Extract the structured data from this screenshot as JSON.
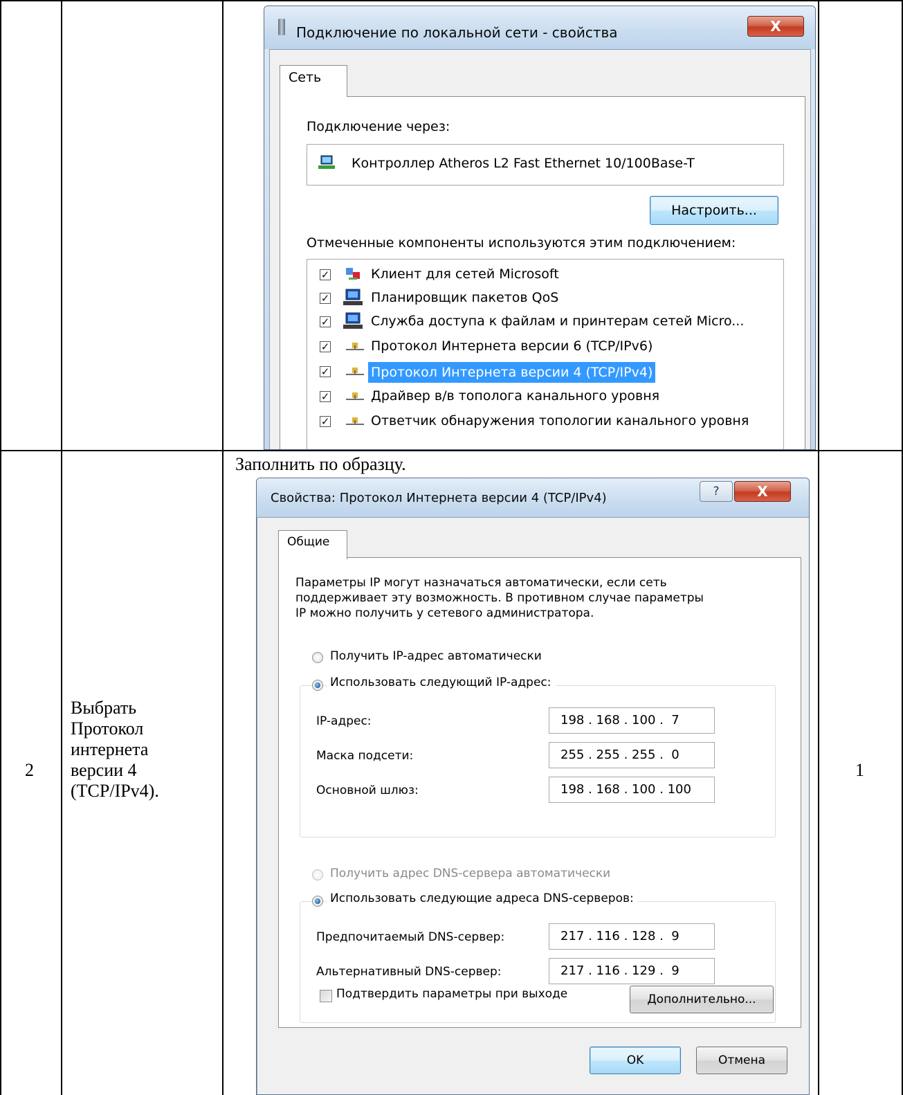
{
  "table": {
    "row2": {
      "num": "2",
      "description": "Выбрать Протокол интернета версии 4 (TCP/IPv4).",
      "instruction": "Заполнить по образцу.",
      "score": "1"
    }
  },
  "dialog1": {
    "title": "Подключение по локальной сети - свойства",
    "tab": "Сеть",
    "connect_label": "Подключение через:",
    "adapter": "Контроллер Atheros L2 Fast Ethernet 10/100Base-T",
    "configure_button": "Настроить...",
    "components_label": "Отмеченные компоненты используются этим подключением:",
    "components": [
      {
        "label": "Клиент для сетей Microsoft",
        "checked": true,
        "icon": "network-client-icon"
      },
      {
        "label": "Планировщик пакетов QoS",
        "checked": true,
        "icon": "computer-icon"
      },
      {
        "label": "Служба доступа к файлам и принтерам сетей Micro...",
        "checked": true,
        "icon": "computer-icon"
      },
      {
        "label": "Протокол Интернета версии 6 (TCP/IPv6)",
        "checked": true,
        "icon": "protocol-icon"
      },
      {
        "label": "Протокол Интернета версии 4 (TCP/IPv4)",
        "checked": true,
        "icon": "protocol-icon",
        "selected": true
      },
      {
        "label": "Драйвер в/в тополога канального уровня",
        "checked": true,
        "icon": "protocol-icon"
      },
      {
        "label": "Ответчик обнаружения топологии канального уровня",
        "checked": true,
        "icon": "protocol-icon"
      }
    ]
  },
  "dialog2": {
    "title": "Свойства: Протокол Интернета версии 4 (TCP/IPv4)",
    "tab": "Общие",
    "intro_lines": [
      "Параметры IP могут назначаться автоматически, если сеть",
      "поддерживает эту возможность. В противном случае параметры",
      "IP можно получить у сетевого администратора."
    ],
    "radio_auto_ip": "Получить IP-адрес автоматически",
    "radio_manual_ip": "Использовать следующий IP-адрес:",
    "ip_label": "IP-адрес:",
    "ip_value": "198 . 168 . 100 .  7",
    "mask_label": "Маска подсети:",
    "mask_value": "255 . 255 . 255 .  0",
    "gateway_label": "Основной шлюз:",
    "gateway_value": "198 . 168 . 100 . 100",
    "radio_auto_dns": "Получить адрес DNS-сервера автоматически",
    "radio_manual_dns": "Использовать следующие адреса DNS-серверов:",
    "dns1_label": "Предпочитаемый DNS-сервер:",
    "dns1_value": "217 . 116 . 128 .  9",
    "dns2_label": "Альтернативный DNS-сервер:",
    "dns2_value": "217 . 116 . 129 .  9",
    "validate_label": "Подтвердить параметры при выходе",
    "advanced_button": "Дополнительно...",
    "ok_button": "OK",
    "cancel_button": "Отмена",
    "help_glyph": "?",
    "close_glyph": "X"
  },
  "dialog1_close_glyph": "X",
  "colors": {
    "selection": "#3399ff",
    "close_red": "#c43c20",
    "title_blue": "#c9dcef"
  }
}
